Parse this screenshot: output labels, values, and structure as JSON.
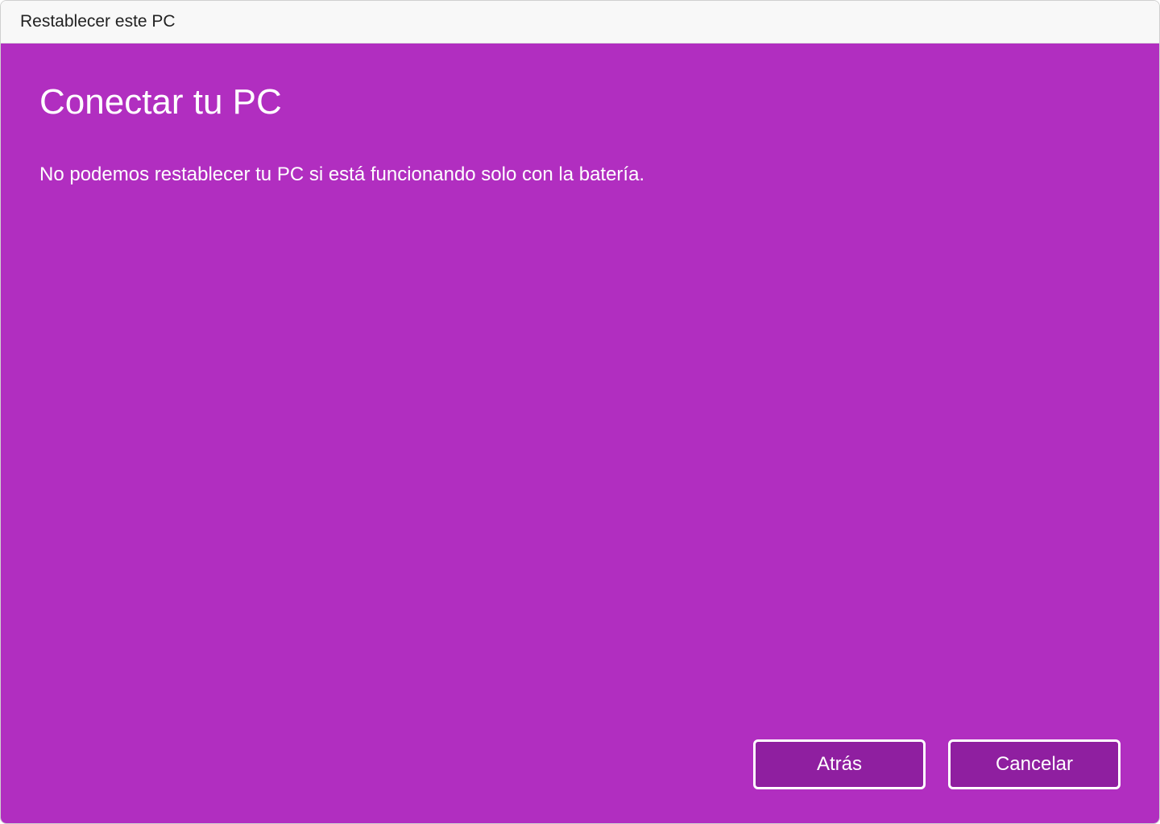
{
  "window": {
    "title": "Restablecer este PC"
  },
  "content": {
    "heading": "Conectar tu PC",
    "message": "No podemos restablecer tu PC si está funcionando solo con la batería."
  },
  "buttons": {
    "back_label": "Atrás",
    "cancel_label": "Cancelar"
  },
  "colors": {
    "accent": "#b12ec0",
    "button_bg": "#8f1fa0"
  }
}
